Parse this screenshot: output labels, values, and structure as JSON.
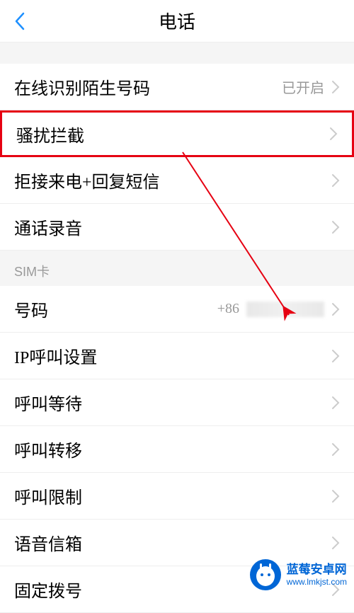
{
  "header": {
    "title": "电话"
  },
  "items": [
    {
      "label": "在线识别陌生号码",
      "value": "已开启",
      "highlighted": false
    },
    {
      "label": "骚扰拦截",
      "value": "",
      "highlighted": true
    },
    {
      "label": "拒接来电+回复短信",
      "value": "",
      "highlighted": false
    },
    {
      "label": "通话录音",
      "value": "",
      "highlighted": false
    }
  ],
  "section": {
    "title": "SIM卡"
  },
  "sim_items": [
    {
      "label": "号码",
      "value": "+86",
      "blurred": true
    },
    {
      "label": "IP呼叫设置",
      "value": ""
    },
    {
      "label": "呼叫等待",
      "value": ""
    },
    {
      "label": "呼叫转移",
      "value": ""
    },
    {
      "label": "呼叫限制",
      "value": ""
    },
    {
      "label": "语音信箱",
      "value": ""
    },
    {
      "label": "固定拨号",
      "value": ""
    }
  ],
  "watermark": {
    "title": "蓝莓安卓网",
    "url": "www.lmkjst.com"
  },
  "colors": {
    "highlight": "#e60012",
    "accent": "#1E90FF",
    "brand": "#0066d6"
  }
}
